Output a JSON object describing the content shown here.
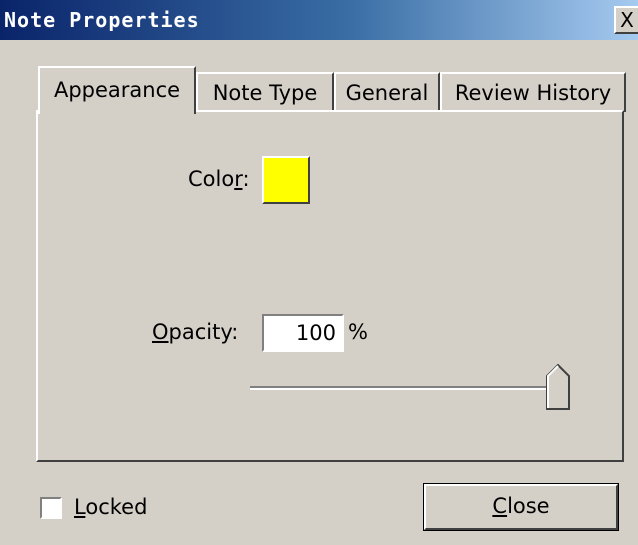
{
  "window": {
    "title": "Note Properties",
    "close_glyph": "X"
  },
  "tabs": [
    {
      "label": "Appearance",
      "active": true
    },
    {
      "label": "Note Type",
      "active": false
    },
    {
      "label": "General",
      "active": false
    },
    {
      "label": "Review History",
      "active": false
    }
  ],
  "appearance": {
    "color_label_pre": "Colo",
    "color_label_mnemonic": "r",
    "color_label_post": ":",
    "color_value": "#ffff00",
    "opacity_label_mnemonic": "O",
    "opacity_label_rest": "pacity:",
    "opacity_value": "100",
    "opacity_unit": "%",
    "opacity_slider_fraction": 1.0
  },
  "footer": {
    "locked_mnemonic": "L",
    "locked_rest": "ocked",
    "locked_checked": false,
    "close_mnemonic": "C",
    "close_rest": "lose"
  }
}
